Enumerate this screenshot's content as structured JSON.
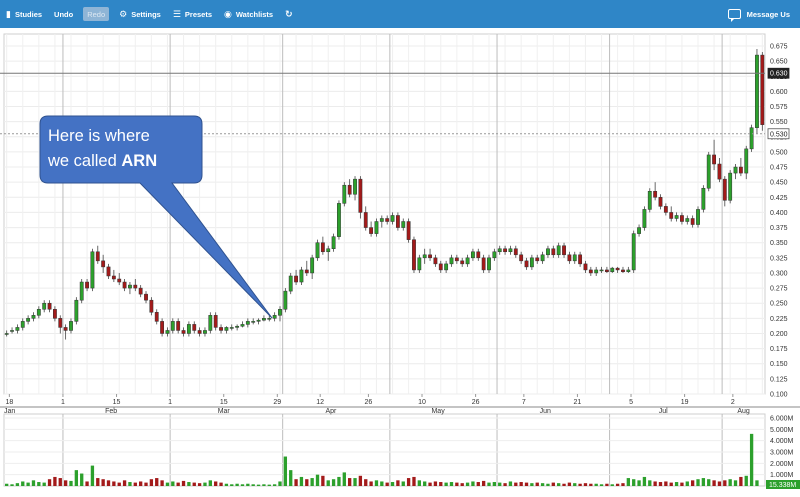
{
  "toolbar": {
    "studies": "Studies",
    "undo": "Undo",
    "redo": "Redo",
    "settings": "Settings",
    "presets": "Presets",
    "watchlists": "Watchlists",
    "message": "Message Us",
    "studies_icon": "book-icon",
    "settings_icon": "gear-icon",
    "presets_icon": "list-icon",
    "watchlists_icon": "binoculars-icon",
    "refresh_icon": "refresh-icon",
    "message_icon": "chat-icon"
  },
  "annotation": {
    "line1": "Here is where",
    "line2_prefix": "we called ",
    "line2_bold": "ARN"
  },
  "colors": {
    "up": "#2ca02c",
    "down": "#a31a1a",
    "callout": "#4472c4",
    "toolbar": "#2f86c7"
  },
  "chart_data": {
    "type": "candlestick",
    "price_axis": {
      "ylim": [
        0.1,
        0.675
      ],
      "ticks": [
        "0.675",
        "0.650",
        "0.625",
        "0.600",
        "0.575",
        "0.550",
        "0.525",
        "0.500",
        "0.475",
        "0.450",
        "0.425",
        "0.400",
        "0.375",
        "0.350",
        "0.325",
        "0.300",
        "0.275",
        "0.250",
        "0.225",
        "0.200",
        "0.175",
        "0.150",
        "0.125",
        "0.100"
      ]
    },
    "price_labels": [
      {
        "value": 0.63,
        "text": "0.630",
        "style": "dark"
      },
      {
        "value": 0.53,
        "text": "0.530",
        "style": "light"
      }
    ],
    "volume_axis": {
      "ylim": [
        0,
        6000000
      ],
      "ticks": [
        {
          "value": 6000000,
          "text": "6.000M"
        },
        {
          "value": 5000000,
          "text": "5.000M"
        },
        {
          "value": 4000000,
          "text": "4.000M"
        },
        {
          "value": 3000000,
          "text": "3.000M"
        },
        {
          "value": 2000000,
          "text": "2.000M"
        },
        {
          "value": 1000000,
          "text": "1.000M"
        }
      ],
      "last_label": "15.338M"
    },
    "x_axis": {
      "day_labels": [
        {
          "day": 1,
          "text": "18"
        },
        {
          "day": 11,
          "text": "1"
        },
        {
          "day": 21,
          "text": "15"
        },
        {
          "day": 31,
          "text": "1"
        },
        {
          "day": 41,
          "text": "15"
        },
        {
          "day": 51,
          "text": "29"
        },
        {
          "day": 59,
          "text": "12"
        },
        {
          "day": 68,
          "text": "26"
        },
        {
          "day": 78,
          "text": "10"
        },
        {
          "day": 88,
          "text": "26"
        },
        {
          "day": 97,
          "text": "7"
        },
        {
          "day": 107,
          "text": "21"
        },
        {
          "day": 117,
          "text": "5"
        },
        {
          "day": 127,
          "text": "19"
        },
        {
          "day": 136,
          "text": "2"
        }
      ],
      "month_labels": [
        {
          "day": 0,
          "text": "Jan"
        },
        {
          "day": 20,
          "text": "Feb"
        },
        {
          "day": 41,
          "text": "Mar"
        },
        {
          "day": 61,
          "text": "Apr"
        },
        {
          "day": 81,
          "text": "May"
        },
        {
          "day": 101,
          "text": "Jun"
        },
        {
          "day": 123,
          "text": "Jul"
        },
        {
          "day": 138,
          "text": "Aug"
        }
      ],
      "grid_days": [
        11,
        31,
        52,
        72,
        92,
        113,
        134
      ]
    },
    "ohlc": [
      [
        0.2,
        0.205,
        0.195,
        0.2
      ],
      [
        0.205,
        0.21,
        0.2,
        0.205
      ],
      [
        0.205,
        0.215,
        0.2,
        0.21
      ],
      [
        0.21,
        0.225,
        0.205,
        0.22
      ],
      [
        0.22,
        0.23,
        0.215,
        0.225
      ],
      [
        0.225,
        0.235,
        0.22,
        0.23
      ],
      [
        0.23,
        0.245,
        0.225,
        0.24
      ],
      [
        0.24,
        0.255,
        0.235,
        0.25
      ],
      [
        0.25,
        0.255,
        0.235,
        0.24
      ],
      [
        0.24,
        0.245,
        0.22,
        0.225
      ],
      [
        0.225,
        0.23,
        0.2,
        0.21
      ],
      [
        0.21,
        0.215,
        0.19,
        0.205
      ],
      [
        0.205,
        0.225,
        0.2,
        0.22
      ],
      [
        0.22,
        0.26,
        0.215,
        0.255
      ],
      [
        0.255,
        0.29,
        0.25,
        0.285
      ],
      [
        0.285,
        0.29,
        0.27,
        0.275
      ],
      [
        0.275,
        0.34,
        0.27,
        0.335
      ],
      [
        0.335,
        0.345,
        0.315,
        0.32
      ],
      [
        0.32,
        0.33,
        0.3,
        0.31
      ],
      [
        0.31,
        0.315,
        0.29,
        0.295
      ],
      [
        0.295,
        0.305,
        0.285,
        0.29
      ],
      [
        0.29,
        0.3,
        0.28,
        0.285
      ],
      [
        0.285,
        0.29,
        0.27,
        0.275
      ],
      [
        0.275,
        0.285,
        0.265,
        0.28
      ],
      [
        0.28,
        0.29,
        0.27,
        0.275
      ],
      [
        0.275,
        0.28,
        0.26,
        0.265
      ],
      [
        0.265,
        0.27,
        0.25,
        0.255
      ],
      [
        0.255,
        0.26,
        0.23,
        0.235
      ],
      [
        0.235,
        0.24,
        0.215,
        0.22
      ],
      [
        0.22,
        0.225,
        0.195,
        0.2
      ],
      [
        0.2,
        0.21,
        0.195,
        0.205
      ],
      [
        0.205,
        0.225,
        0.2,
        0.22
      ],
      [
        0.22,
        0.225,
        0.2,
        0.205
      ],
      [
        0.205,
        0.21,
        0.195,
        0.2
      ],
      [
        0.2,
        0.22,
        0.195,
        0.215
      ],
      [
        0.215,
        0.22,
        0.2,
        0.205
      ],
      [
        0.205,
        0.21,
        0.195,
        0.2
      ],
      [
        0.2,
        0.21,
        0.195,
        0.205
      ],
      [
        0.205,
        0.235,
        0.2,
        0.23
      ],
      [
        0.23,
        0.235,
        0.205,
        0.21
      ],
      [
        0.21,
        0.215,
        0.2,
        0.205
      ],
      [
        0.205,
        0.212,
        0.2,
        0.21
      ],
      [
        0.21,
        0.215,
        0.205,
        0.21
      ],
      [
        0.21,
        0.215,
        0.205,
        0.212
      ],
      [
        0.212,
        0.22,
        0.21,
        0.215
      ],
      [
        0.215,
        0.225,
        0.21,
        0.22
      ],
      [
        0.22,
        0.225,
        0.215,
        0.22
      ],
      [
        0.22,
        0.225,
        0.215,
        0.222
      ],
      [
        0.222,
        0.23,
        0.22,
        0.225
      ],
      [
        0.225,
        0.23,
        0.22,
        0.225
      ],
      [
        0.225,
        0.235,
        0.22,
        0.23
      ],
      [
        0.23,
        0.245,
        0.22,
        0.24
      ],
      [
        0.24,
        0.275,
        0.235,
        0.27
      ],
      [
        0.27,
        0.3,
        0.265,
        0.295
      ],
      [
        0.295,
        0.305,
        0.28,
        0.285
      ],
      [
        0.285,
        0.31,
        0.28,
        0.305
      ],
      [
        0.305,
        0.32,
        0.295,
        0.3
      ],
      [
        0.3,
        0.33,
        0.29,
        0.325
      ],
      [
        0.325,
        0.355,
        0.32,
        0.35
      ],
      [
        0.35,
        0.36,
        0.33,
        0.335
      ],
      [
        0.335,
        0.345,
        0.32,
        0.34
      ],
      [
        0.34,
        0.365,
        0.335,
        0.36
      ],
      [
        0.36,
        0.42,
        0.355,
        0.415
      ],
      [
        0.415,
        0.45,
        0.41,
        0.445
      ],
      [
        0.445,
        0.455,
        0.425,
        0.43
      ],
      [
        0.43,
        0.46,
        0.42,
        0.455
      ],
      [
        0.455,
        0.46,
        0.39,
        0.4
      ],
      [
        0.4,
        0.41,
        0.37,
        0.375
      ],
      [
        0.375,
        0.385,
        0.36,
        0.365
      ],
      [
        0.365,
        0.39,
        0.36,
        0.385
      ],
      [
        0.385,
        0.395,
        0.375,
        0.39
      ],
      [
        0.39,
        0.395,
        0.38,
        0.385
      ],
      [
        0.385,
        0.4,
        0.38,
        0.395
      ],
      [
        0.395,
        0.4,
        0.37,
        0.375
      ],
      [
        0.375,
        0.39,
        0.37,
        0.385
      ],
      [
        0.385,
        0.39,
        0.35,
        0.355
      ],
      [
        0.355,
        0.36,
        0.3,
        0.305
      ],
      [
        0.305,
        0.33,
        0.3,
        0.325
      ],
      [
        0.325,
        0.34,
        0.315,
        0.33
      ],
      [
        0.33,
        0.34,
        0.32,
        0.325
      ],
      [
        0.325,
        0.33,
        0.31,
        0.315
      ],
      [
        0.315,
        0.32,
        0.3,
        0.305
      ],
      [
        0.305,
        0.32,
        0.3,
        0.315
      ],
      [
        0.315,
        0.33,
        0.31,
        0.325
      ],
      [
        0.325,
        0.33,
        0.315,
        0.32
      ],
      [
        0.32,
        0.325,
        0.31,
        0.315
      ],
      [
        0.315,
        0.33,
        0.31,
        0.325
      ],
      [
        0.325,
        0.34,
        0.32,
        0.335
      ],
      [
        0.335,
        0.34,
        0.32,
        0.325
      ],
      [
        0.325,
        0.33,
        0.3,
        0.305
      ],
      [
        0.305,
        0.33,
        0.3,
        0.325
      ],
      [
        0.325,
        0.34,
        0.32,
        0.335
      ],
      [
        0.335,
        0.345,
        0.33,
        0.34
      ],
      [
        0.34,
        0.345,
        0.33,
        0.335
      ],
      [
        0.335,
        0.345,
        0.33,
        0.34
      ],
      [
        0.34,
        0.345,
        0.325,
        0.33
      ],
      [
        0.33,
        0.335,
        0.315,
        0.32
      ],
      [
        0.32,
        0.325,
        0.305,
        0.31
      ],
      [
        0.31,
        0.33,
        0.305,
        0.325
      ],
      [
        0.325,
        0.33,
        0.315,
        0.32
      ],
      [
        0.32,
        0.335,
        0.315,
        0.33
      ],
      [
        0.33,
        0.345,
        0.325,
        0.34
      ],
      [
        0.34,
        0.345,
        0.325,
        0.33
      ],
      [
        0.33,
        0.35,
        0.325,
        0.345
      ],
      [
        0.345,
        0.35,
        0.325,
        0.33
      ],
      [
        0.33,
        0.335,
        0.315,
        0.32
      ],
      [
        0.32,
        0.335,
        0.315,
        0.33
      ],
      [
        0.33,
        0.335,
        0.31,
        0.315
      ],
      [
        0.315,
        0.32,
        0.3,
        0.305
      ],
      [
        0.305,
        0.31,
        0.295,
        0.3
      ],
      [
        0.3,
        0.31,
        0.295,
        0.305
      ],
      [
        0.305,
        0.31,
        0.3,
        0.305
      ],
      [
        0.305,
        0.31,
        0.3,
        0.302
      ],
      [
        0.302,
        0.31,
        0.3,
        0.308
      ],
      [
        0.308,
        0.31,
        0.3,
        0.305
      ],
      [
        0.305,
        0.31,
        0.3,
        0.302
      ],
      [
        0.302,
        0.31,
        0.3,
        0.305
      ],
      [
        0.305,
        0.37,
        0.3,
        0.365
      ],
      [
        0.365,
        0.38,
        0.36,
        0.375
      ],
      [
        0.375,
        0.41,
        0.37,
        0.405
      ],
      [
        0.405,
        0.44,
        0.4,
        0.435
      ],
      [
        0.435,
        0.45,
        0.42,
        0.425
      ],
      [
        0.425,
        0.43,
        0.405,
        0.41
      ],
      [
        0.41,
        0.415,
        0.395,
        0.4
      ],
      [
        0.4,
        0.41,
        0.385,
        0.39
      ],
      [
        0.39,
        0.4,
        0.385,
        0.395
      ],
      [
        0.395,
        0.4,
        0.38,
        0.385
      ],
      [
        0.385,
        0.395,
        0.38,
        0.39
      ],
      [
        0.39,
        0.395,
        0.375,
        0.38
      ],
      [
        0.38,
        0.41,
        0.375,
        0.405
      ],
      [
        0.405,
        0.445,
        0.4,
        0.44
      ],
      [
        0.44,
        0.5,
        0.435,
        0.495
      ],
      [
        0.495,
        0.52,
        0.47,
        0.48
      ],
      [
        0.48,
        0.49,
        0.45,
        0.455
      ],
      [
        0.455,
        0.46,
        0.41,
        0.42
      ],
      [
        0.42,
        0.47,
        0.415,
        0.465
      ],
      [
        0.465,
        0.48,
        0.455,
        0.475
      ],
      [
        0.475,
        0.49,
        0.46,
        0.465
      ],
      [
        0.465,
        0.51,
        0.455,
        0.505
      ],
      [
        0.505,
        0.545,
        0.5,
        0.54
      ],
      [
        0.54,
        0.67,
        0.53,
        0.66
      ],
      [
        0.66,
        0.665,
        0.535,
        0.545
      ]
    ],
    "volume": [
      200000,
      150000,
      250000,
      400000,
      300000,
      500000,
      350000,
      300000,
      600000,
      800000,
      700000,
      500000,
      450000,
      1400000,
      1100000,
      400000,
      1800000,
      700000,
      600000,
      500000,
      400000,
      300000,
      500000,
      350000,
      300000,
      400000,
      300000,
      600000,
      700000,
      500000,
      300000,
      400000,
      300000,
      450000,
      350000,
      300000,
      250000,
      300000,
      500000,
      400000,
      300000,
      200000,
      150000,
      200000,
      150000,
      200000,
      150000,
      120000,
      150000,
      120000,
      150000,
      400000,
      2600000,
      1400000,
      600000,
      800000,
      600000,
      700000,
      1000000,
      900000,
      500000,
      600000,
      800000,
      1200000,
      700000,
      700000,
      900000,
      600000,
      400000,
      500000,
      400000,
      300000,
      350000,
      500000,
      400000,
      700000,
      800000,
      500000,
      400000,
      300000,
      400000,
      350000,
      300000,
      350000,
      300000,
      250000,
      300000,
      400000,
      350000,
      450000,
      300000,
      350000,
      300000,
      250000,
      400000,
      300000,
      350000,
      300000,
      250000,
      300000,
      250000,
      200000,
      300000,
      250000,
      200000,
      300000,
      250000,
      200000,
      250000,
      200000,
      200000,
      150000,
      200000,
      150000,
      200000,
      250000,
      700000,
      600000,
      500000,
      800000,
      500000,
      400000,
      350000,
      400000,
      300000,
      350000,
      300000,
      400000,
      500000,
      600000,
      700000,
      600000,
      500000,
      400000,
      500000,
      600000,
      500000,
      800000,
      900000,
      4600000,
      500000
    ]
  }
}
